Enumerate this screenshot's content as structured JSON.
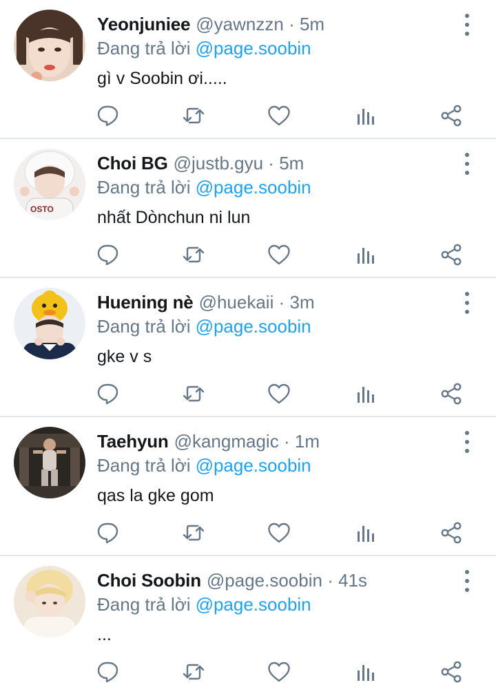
{
  "colors": {
    "accent": "#1da1f2",
    "secondary_text": "#657786",
    "divider": "#e1e8ed",
    "icon": "#657786"
  },
  "icons": {
    "more": "vertical-ellipsis",
    "reply": "speech-bubble",
    "retweet": "retweet-arrows",
    "like": "heart-outline",
    "stats": "bar-chart",
    "share": "share-nodes"
  },
  "tweets": [
    {
      "name": "Yeonjuniee",
      "handle": "@yawnzzn",
      "separator": "·",
      "time": "5m",
      "reply_prefix": "Đang trả lời",
      "reply_to": "@page.soobin",
      "text": "gì v Soobin ơi....."
    },
    {
      "name": "Choi BG",
      "handle": "@justb.gyu",
      "separator": "·",
      "time": "5m",
      "reply_prefix": "Đang trả lời",
      "reply_to": "@page.soobin",
      "text": "nhất Dònchun ni lun"
    },
    {
      "name": "Huening nè",
      "handle": "@huekaii",
      "separator": "·",
      "time": "3m",
      "reply_prefix": "Đang trả lời",
      "reply_to": "@page.soobin",
      "text": "gke v s"
    },
    {
      "name": "Taehyun",
      "handle": "@kangmagic",
      "separator": "·",
      "time": "1m",
      "reply_prefix": "Đang trả lời",
      "reply_to": "@page.soobin",
      "text": "qas la gke gom"
    },
    {
      "name": "Choi Soobin",
      "handle": "@page.soobin",
      "separator": "·",
      "time": "41s",
      "reply_prefix": "Đang trả lời",
      "reply_to": "@page.soobin",
      "text": "..."
    }
  ]
}
